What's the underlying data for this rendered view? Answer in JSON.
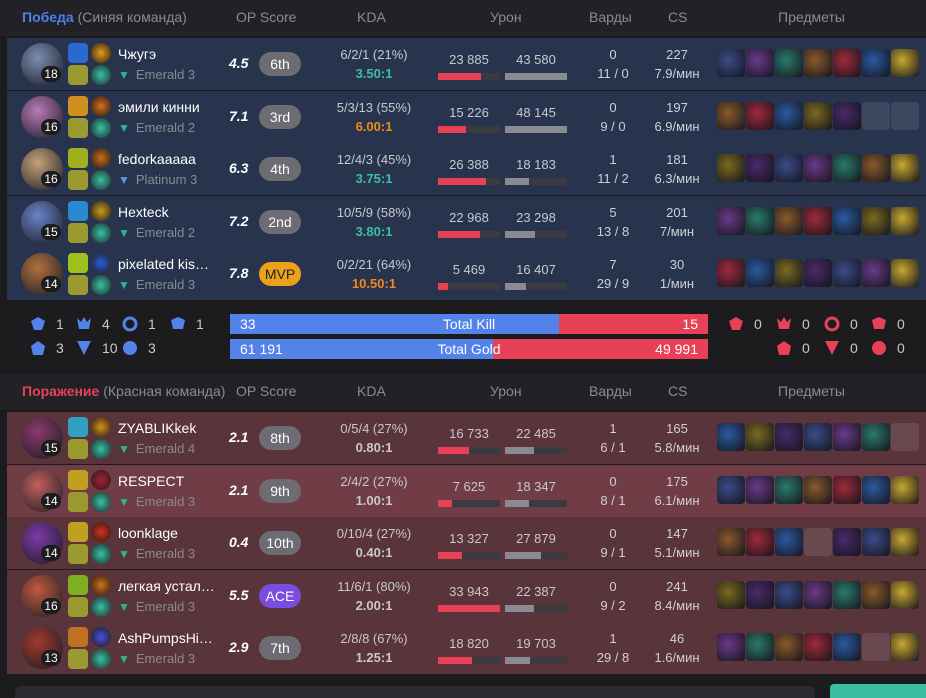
{
  "columns": {
    "op_score": "OP Score",
    "kda": "KDA",
    "damage": "Урон",
    "wards": "Варды",
    "cs": "CS",
    "items": "Предметы"
  },
  "win_team": {
    "result": "Победа",
    "side": "(Синяя команда)",
    "players": [
      {
        "name": "Чжугэ",
        "level": "18",
        "rank": "Emerald 3",
        "op": "4.5",
        "badge": "6th",
        "kda": "6/2/1 (21%)",
        "ratio": "3.50:1",
        "dmg": "23 885",
        "taken": "43 580",
        "dmg_fill": 0.7,
        "taken_fill": 1.0,
        "wards": "0",
        "wards2": "11 / 0",
        "cs": "227",
        "cs_rate": "7.9/мин"
      },
      {
        "name": "эмили кинни",
        "level": "16",
        "rank": "Emerald 2",
        "op": "7.1",
        "badge": "3rd",
        "kda": "5/3/13 (55%)",
        "ratio": "6.00:1",
        "dmg": "15 226",
        "taken": "48 145",
        "dmg_fill": 0.45,
        "taken_fill": 1.0,
        "wards": "0",
        "wards2": "9 / 0",
        "cs": "197",
        "cs_rate": "6.9/мин"
      },
      {
        "name": "fedorkaaaaa",
        "level": "16",
        "rank": "Platinum 3",
        "op": "6.3",
        "badge": "4th",
        "kda": "12/4/3 (45%)",
        "ratio": "3.75:1",
        "dmg": "26 388",
        "taken": "18 183",
        "dmg_fill": 0.78,
        "taken_fill": 0.38,
        "wards": "1",
        "wards2": "11 / 2",
        "cs": "181",
        "cs_rate": "6.3/мин"
      },
      {
        "name": "Hexteck",
        "level": "15",
        "rank": "Emerald 2",
        "op": "7.2",
        "badge": "2nd",
        "kda": "10/5/9 (58%)",
        "ratio": "3.80:1",
        "dmg": "22 968",
        "taken": "23 298",
        "dmg_fill": 0.68,
        "taken_fill": 0.48,
        "wards": "5",
        "wards2": "13 / 8",
        "cs": "201",
        "cs_rate": "7/мин"
      },
      {
        "name": "pixelated kis…",
        "level": "14",
        "rank": "Emerald 3",
        "op": "7.8",
        "badge": "MVP",
        "kda": "0/2/21 (64%)",
        "ratio": "10.50:1",
        "dmg": "5 469",
        "taken": "16 407",
        "dmg_fill": 0.16,
        "taken_fill": 0.34,
        "wards": "7",
        "wards2": "29 / 9",
        "cs": "30",
        "cs_rate": "1/мин"
      }
    ]
  },
  "lose_team": {
    "result": "Поражение",
    "side": "(Красная команда)",
    "players": [
      {
        "name": "ZYABLIKkek",
        "level": "15",
        "rank": "Emerald 4",
        "op": "2.1",
        "badge": "8th",
        "kda": "0/5/4 (27%)",
        "ratio": "0.80:1",
        "dmg": "16 733",
        "taken": "22 485",
        "dmg_fill": 0.5,
        "taken_fill": 0.47,
        "wards": "1",
        "wards2": "6 / 1",
        "cs": "165",
        "cs_rate": "5.8/мин"
      },
      {
        "name": "RESPECT",
        "level": "14",
        "rank": "Emerald 3",
        "op": "2.1",
        "badge": "9th",
        "kda": "2/4/2 (27%)",
        "ratio": "1.00:1",
        "dmg": "7 625",
        "taken": "18 347",
        "dmg_fill": 0.22,
        "taken_fill": 0.38,
        "wards": "0",
        "wards2": "8 / 1",
        "cs": "175",
        "cs_rate": "6.1/мин"
      },
      {
        "name": "loonklage",
        "level": "14",
        "rank": "Emerald 3",
        "op": "0.4",
        "badge": "10th",
        "kda": "0/10/4 (27%)",
        "ratio": "0.40:1",
        "dmg": "13 327",
        "taken": "27 879",
        "dmg_fill": 0.39,
        "taken_fill": 0.58,
        "wards": "0",
        "wards2": "9 / 1",
        "cs": "147",
        "cs_rate": "5.1/мин"
      },
      {
        "name": "легкая устал…",
        "level": "16",
        "rank": "Emerald 3",
        "op": "5.5",
        "badge": "ACE",
        "kda": "11/6/1 (80%)",
        "ratio": "2.00:1",
        "dmg": "33 943",
        "taken": "22 387",
        "dmg_fill": 1.0,
        "taken_fill": 0.47,
        "wards": "0",
        "wards2": "9 / 2",
        "cs": "241",
        "cs_rate": "8.4/мин"
      },
      {
        "name": "AshPumpsHi…",
        "level": "13",
        "rank": "Emerald 3",
        "op": "2.9",
        "badge": "7th",
        "kda": "2/8/8 (67%)",
        "ratio": "1.25:1",
        "dmg": "18 820",
        "taken": "19 703",
        "dmg_fill": 0.55,
        "taken_fill": 0.41,
        "wards": "1",
        "wards2": "29 / 8",
        "cs": "46",
        "cs_rate": "1.6/мин"
      }
    ]
  },
  "summary": {
    "blue_obj": [
      "1",
      "4",
      "1",
      "1",
      "3",
      "10",
      "3"
    ],
    "red_obj": [
      "0",
      "0",
      "0",
      "0",
      "0",
      "0",
      "0"
    ],
    "total_kill": {
      "label": "Total Kill",
      "blue": "33",
      "red": "15",
      "blue_share": 0.688
    },
    "total_gold": {
      "label": "Total Gold",
      "blue": "61 191",
      "red": "49 991",
      "blue_share": 0.55
    }
  },
  "colors": {
    "accent_blue": "#5383e8",
    "accent_red": "#e84057",
    "mvp": "#eba21b",
    "ace": "#7b4ce0"
  }
}
